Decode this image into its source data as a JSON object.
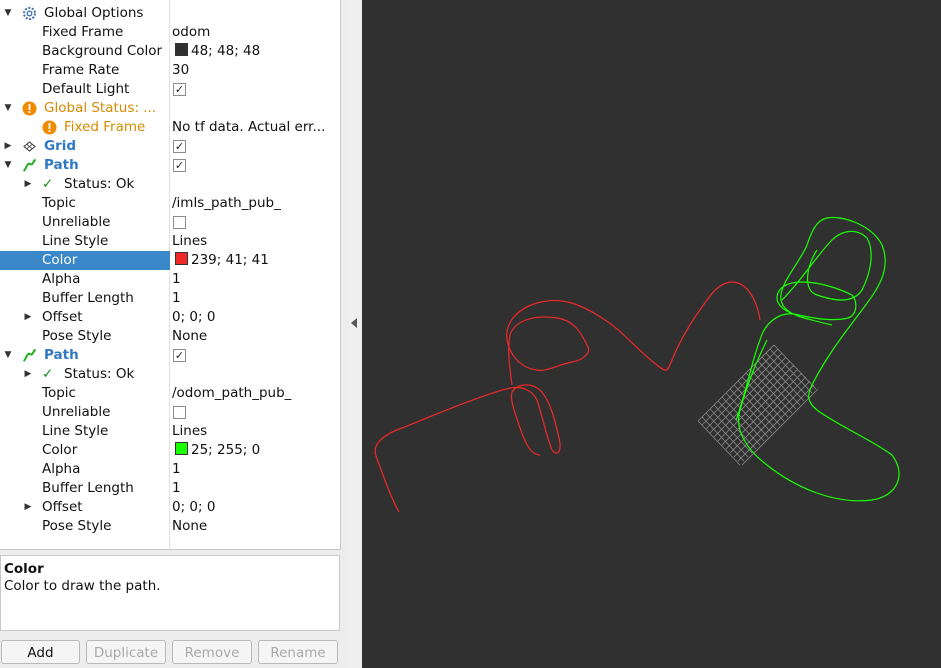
{
  "displays_tree": {
    "global_options": {
      "label": "Global Options"
    },
    "fixed_frame": {
      "label": "Fixed Frame",
      "value": "odom"
    },
    "background_color": {
      "label": "Background Color",
      "value": "48; 48; 48",
      "color": "#303030"
    },
    "frame_rate": {
      "label": "Frame Rate",
      "value": "30"
    },
    "default_light": {
      "label": "Default Light",
      "checked": true
    },
    "global_status": {
      "label": "Global Status: ..."
    },
    "global_status_fixed_frame": {
      "label": "Fixed Frame",
      "value": "No tf data.  Actual err..."
    },
    "grid": {
      "label": "Grid",
      "checked": true
    },
    "path1": {
      "label": "Path",
      "checked": true,
      "status": "Status: Ok",
      "topic_label": "Topic",
      "topic": "/imls_path_pub_",
      "unreliable_label": "Unreliable",
      "unreliable": false,
      "line_style_label": "Line Style",
      "line_style": "Lines",
      "color_label": "Color",
      "color_value": "239; 41; 41",
      "color": "#ef2929",
      "alpha_label": "Alpha",
      "alpha": "1",
      "buffer_length_label": "Buffer Length",
      "buffer_length": "1",
      "offset_label": "Offset",
      "offset": "0; 0; 0",
      "pose_style_label": "Pose Style",
      "pose_style": "None"
    },
    "path2": {
      "label": "Path",
      "checked": true,
      "status": "Status: Ok",
      "topic_label": "Topic",
      "topic": "/odom_path_pub_",
      "unreliable_label": "Unreliable",
      "unreliable": false,
      "line_style_label": "Line Style",
      "line_style": "Lines",
      "color_label": "Color",
      "color_value": "25; 255; 0",
      "color": "#19ff00",
      "alpha_label": "Alpha",
      "alpha": "1",
      "buffer_length_label": "Buffer Length",
      "buffer_length": "1",
      "offset_label": "Offset",
      "offset": "0; 0; 0",
      "pose_style_label": "Pose Style",
      "pose_style": "None"
    }
  },
  "description": {
    "title": "Color",
    "text": "Color to draw the path."
  },
  "buttons": {
    "add": "Add",
    "duplicate": "Duplicate",
    "remove": "Remove",
    "rename": "Rename"
  },
  "colors": {
    "selection": "#3a87c9",
    "accent_blue": "#2f78c4",
    "warning": "#d68a00",
    "grid": "#a0a0a0"
  }
}
